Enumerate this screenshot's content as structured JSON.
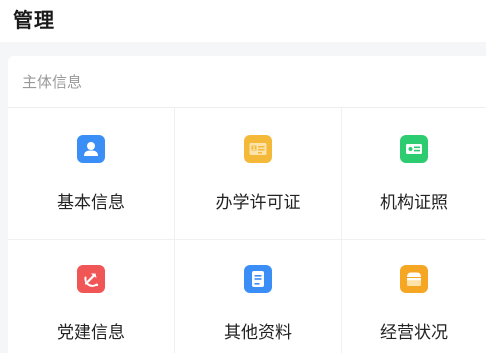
{
  "header": {
    "title": "管理"
  },
  "section": {
    "title": "主体信息",
    "items": [
      {
        "label": "基本信息",
        "icon": "user-icon",
        "color": "#3a8ef6"
      },
      {
        "label": "办学许可证",
        "icon": "license-icon",
        "color": "#f5b93a"
      },
      {
        "label": "机构证照",
        "icon": "id-card-icon",
        "color": "#2ecc71"
      },
      {
        "label": "党建信息",
        "icon": "party-emblem-icon",
        "color": "#f05656"
      },
      {
        "label": "其他资料",
        "icon": "document-icon",
        "color": "#3a8ef6"
      },
      {
        "label": "经营状况",
        "icon": "store-icon",
        "color": "#f5a623"
      }
    ]
  }
}
